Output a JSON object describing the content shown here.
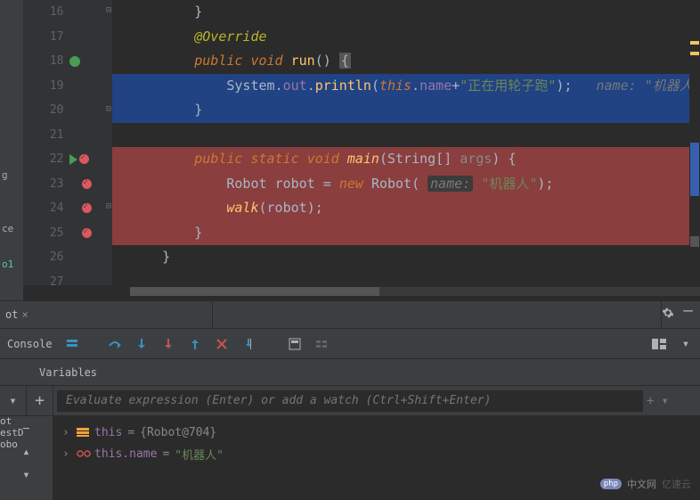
{
  "editor": {
    "lines": {
      "l16": {
        "num": "16",
        "code_close": "}"
      },
      "l17": {
        "num": "17",
        "annotation": "@Override"
      },
      "l18": {
        "num": "18",
        "kw_public": "public",
        "kw_void": "void",
        "method": "run",
        "parens": "()",
        "brace": "{"
      },
      "l19": {
        "num": "19",
        "sys": "System",
        "dot1": ".",
        "out": "out",
        "dot2": ".",
        "println": "println",
        "open": "(",
        "this": "this",
        "dot3": ".",
        "field": "name",
        "plus": "+",
        "str": "\"正在用轮子跑\"",
        "close": ");",
        "hint_lbl": "name:",
        "hint_val": "\"机器人"
      },
      "l20": {
        "num": "20",
        "code_close": "}"
      },
      "l21": {
        "num": "21"
      },
      "l22": {
        "num": "22",
        "kw_public": "public",
        "kw_static": "static",
        "kw_void": "void",
        "method": "main",
        "open": "(",
        "type": "String",
        "arr": "[]",
        "arg": "args",
        "close": ")",
        "brace": "{"
      },
      "l23": {
        "num": "23",
        "type": "Robot",
        "var": "robot",
        "eq": "=",
        "new": "new",
        "ctor": "Robot",
        "open": "(",
        "hint": "name:",
        "str": "\"机器人\"",
        "close": ");"
      },
      "l24": {
        "num": "24",
        "call": "walk",
        "open": "(",
        "arg": "robot",
        "close": ");"
      },
      "l25": {
        "num": "25",
        "code_close": "}"
      },
      "l26": {
        "num": "26",
        "code_close": "}"
      },
      "l27": {
        "num": "27"
      }
    }
  },
  "left_strip": {
    "t1": "g",
    "t2": "ce",
    "t3": "o1"
  },
  "tabbar": {
    "tab_label": "ot",
    "close": "×"
  },
  "debugger_bar": {
    "console": "Console"
  },
  "vars_header": {
    "label": "Variables"
  },
  "watch": {
    "placeholder": "Evaluate expression (Enter) or add a watch (Ctrl+Shift+Enter)"
  },
  "variables": {
    "rows": [
      {
        "name": "this",
        "sep": " = ",
        "val": "{Robot@704}",
        "kind": "object"
      },
      {
        "name": "this.name",
        "sep": " = ",
        "val": "\"机器人\"",
        "kind": "string"
      }
    ]
  },
  "project_frags": {
    "f1": "ot",
    "f2": "estD",
    "f3": "obo"
  },
  "watermark": {
    "php": "php",
    "cn": "中文网",
    "yy": "亿速云"
  }
}
